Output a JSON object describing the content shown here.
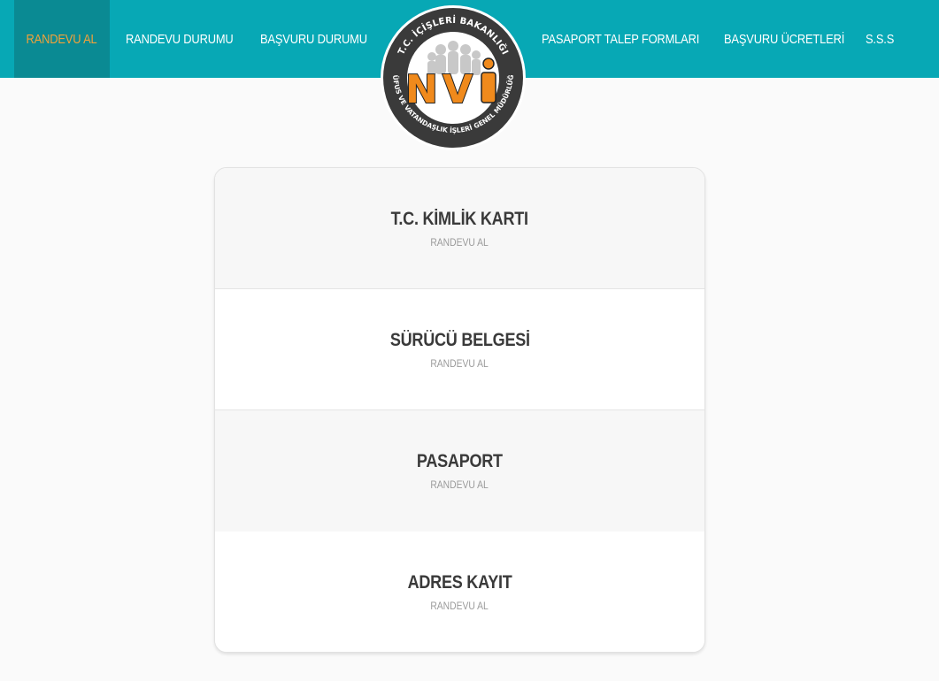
{
  "nav": {
    "items": [
      {
        "label": "RANDEVU AL",
        "active": true
      },
      {
        "label": "RANDEVU DURUMU",
        "active": false
      },
      {
        "label": "BAŞVURU DURUMU",
        "active": false
      },
      {
        "label": "PASAPORT TALEP FORMLARI",
        "active": false
      },
      {
        "label": "BAŞVURU ÜCRETLERİ",
        "active": false
      },
      {
        "label": "S.S.S",
        "active": false
      }
    ]
  },
  "logo": {
    "top_text": "T.C. İÇİŞLERİ BAKANLIĞI",
    "bottom_text": "NÜFUS VE VATANDAŞLIK İŞLERİ GENEL MÜDÜRLÜĞÜ",
    "mark": "NVİ"
  },
  "services": [
    {
      "title": "T.C. KİMLİK KARTI",
      "subtitle": "RANDEVU AL"
    },
    {
      "title": "SÜRÜCÜ BELGESİ",
      "subtitle": "RANDEVU AL"
    },
    {
      "title": "PASAPORT",
      "subtitle": "RANDEVU AL"
    },
    {
      "title": "ADRES KAYIT",
      "subtitle": "RANDEVU AL"
    }
  ],
  "colors": {
    "topbar": "#07a8b5",
    "active_nav_bg": "#0a8a93",
    "active_nav_text": "#f2a23a",
    "logo_orange": "#f08a1c"
  }
}
